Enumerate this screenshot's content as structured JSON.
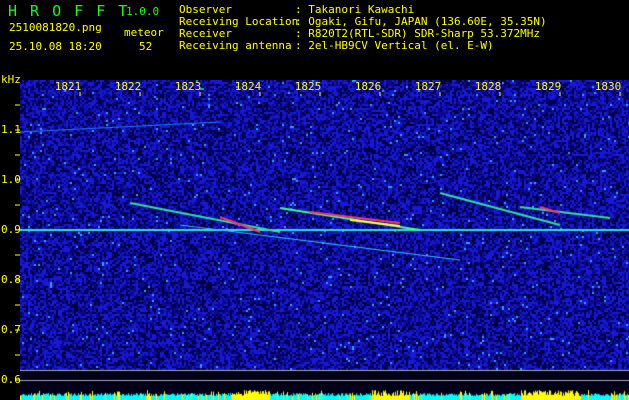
{
  "app": {
    "title": "H R O F F T",
    "version": "1.0.0"
  },
  "file": {
    "name": "2510081820.png",
    "datetime": "25.10.08 18:20"
  },
  "meteor": {
    "label": "meteor",
    "count": "52"
  },
  "info": [
    {
      "label": "Observer",
      "value": ": Takanori Kawachi"
    },
    {
      "label": "Receiving Location",
      "value": ": Ogaki, Gifu, JAPAN (136.60E, 35.35N)"
    },
    {
      "label": "Receiver",
      "value": ": R820T2(RTL-SDR) SDR-Sharp 53.372MHz"
    },
    {
      "label": "Receiving antenna",
      "value": ": 2el-HB9CV Vertical (el. E-W)"
    }
  ],
  "axis": {
    "y_unit": "kHz",
    "y_ticks": [
      "1.1",
      "1.0",
      "0.9",
      "0.8",
      "0.7",
      "0.6"
    ],
    "x_ticks": [
      "1821",
      "1822",
      "1823",
      "1824",
      "1825",
      "1826",
      "1827",
      "1828",
      "1829",
      "1830"
    ]
  },
  "colors": {
    "text": "#ffff00",
    "title": "#22ee22",
    "noise": "#0000c0",
    "histogram_low": "#00ffff",
    "histogram_high": "#ffff00"
  }
}
